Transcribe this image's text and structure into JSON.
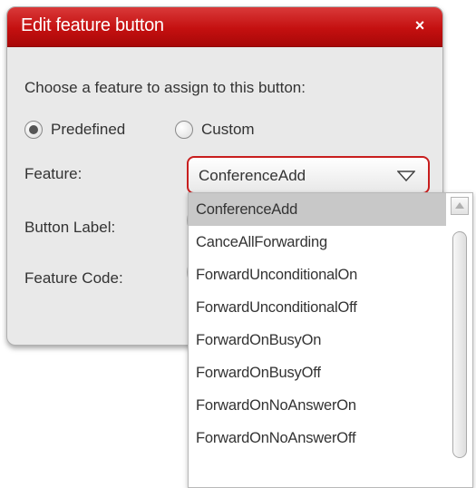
{
  "dialog": {
    "title": "Edit feature button",
    "close_label": "×",
    "prompt": "Choose a feature to assign to this button:",
    "radios": {
      "predefined_label": "Predefined",
      "predefined_checked": true,
      "custom_label": "Custom",
      "custom_checked": false
    },
    "labels": {
      "feature": "Feature:",
      "button_label": "Button Label:",
      "feature_code": "Feature Code:"
    },
    "feature_select": {
      "value": "ConferenceAdd",
      "options": [
        "ConferenceAdd",
        "CanceAllForwarding",
        "ForwardUnconditionalOn",
        "ForwardUnconditionalOff",
        "ForwardOnBusyOn",
        "ForwardOnBusyOff",
        "ForwardOnNoAnswerOn",
        "ForwardOnNoAnswerOff"
      ],
      "highlighted_index": 0
    }
  },
  "colors": {
    "title_bar": "#c41010",
    "select_border": "#c81e1e",
    "highlight": "#c8c8c8"
  },
  "icons": {
    "close": "close-icon",
    "select_arrow": "chevron-down-icon",
    "scroll_up": "arrow-up-icon"
  }
}
